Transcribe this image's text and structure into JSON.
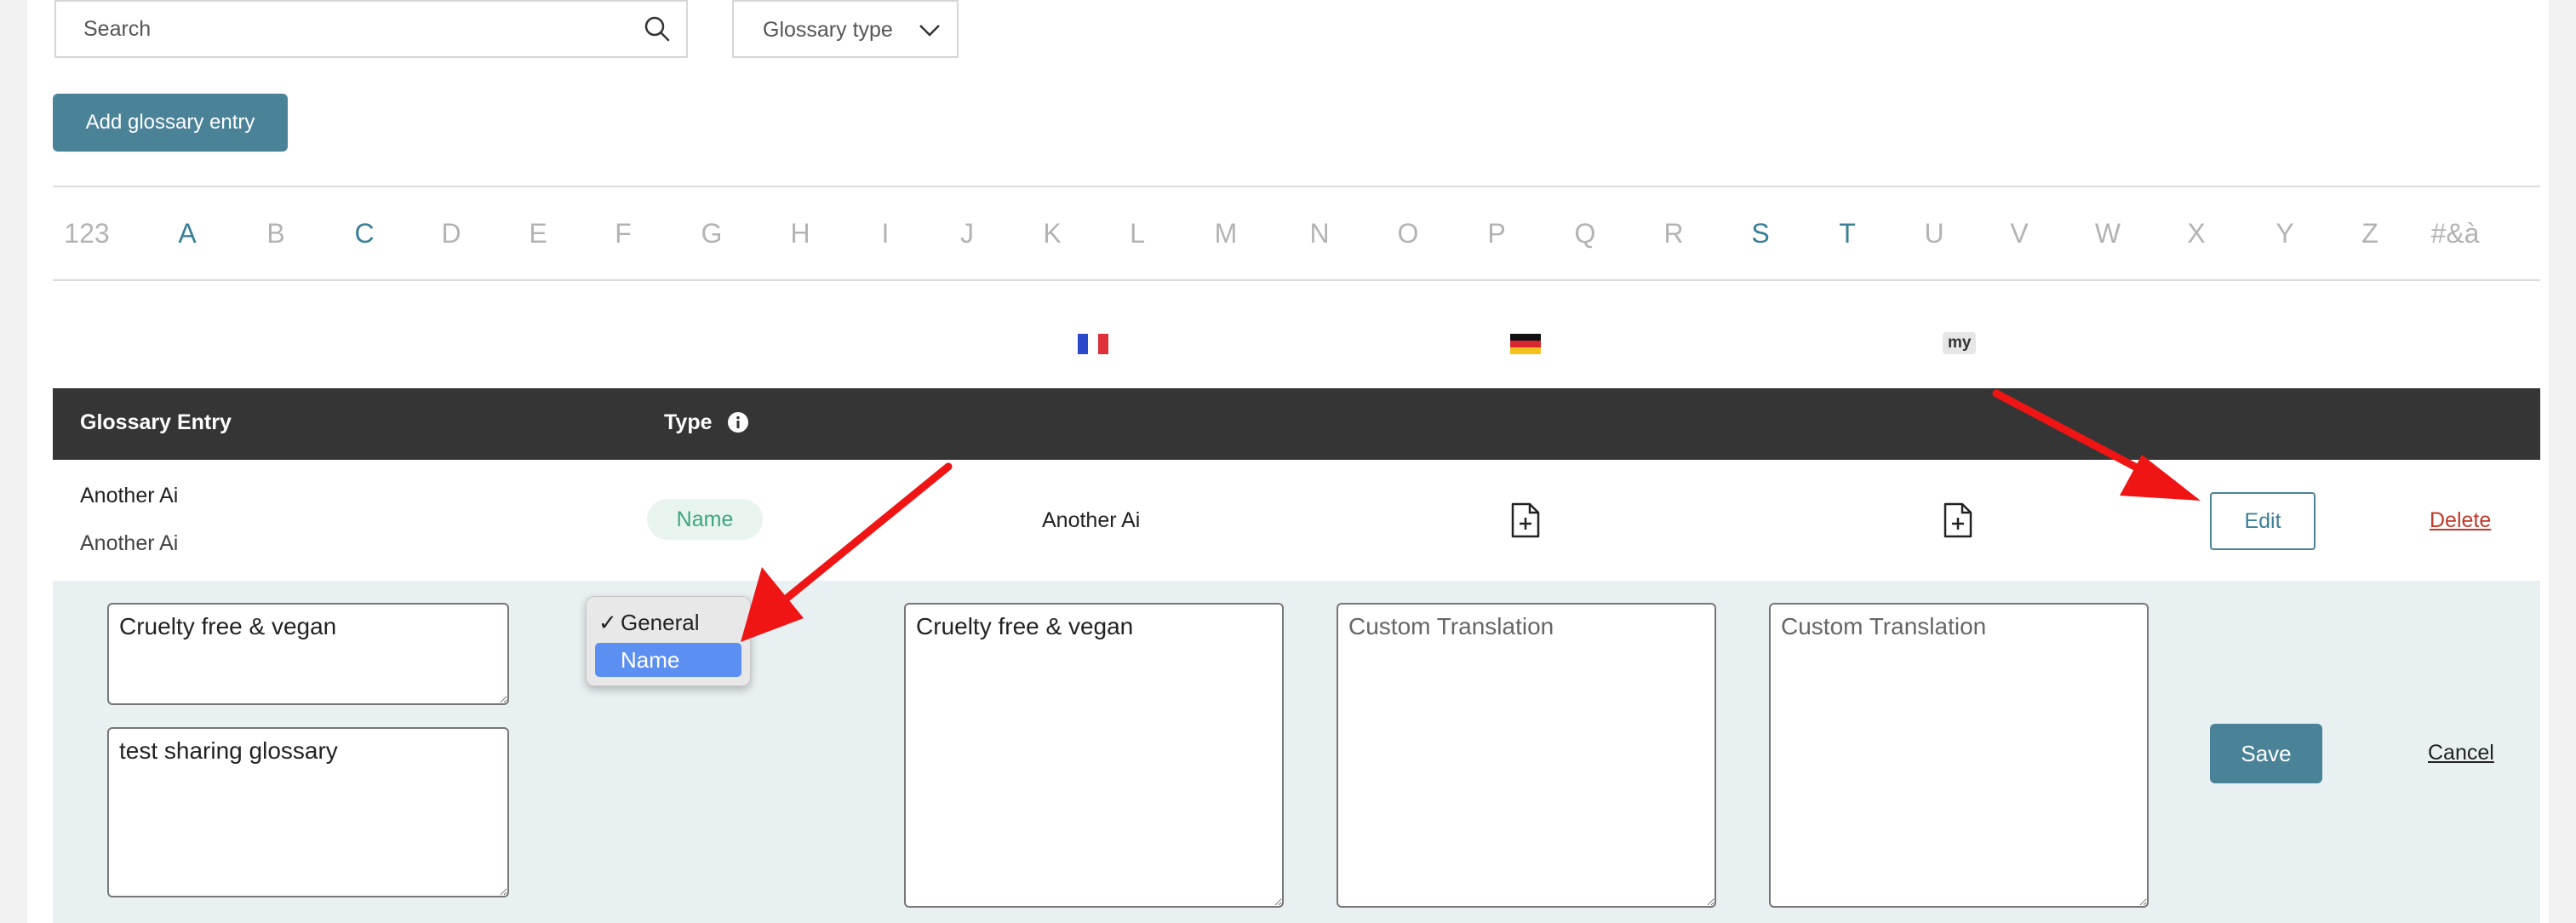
{
  "search": {
    "placeholder": "Search"
  },
  "filter": {
    "glossary_type_label": "Glossary type"
  },
  "actions": {
    "add_entry_label": "Add glossary entry"
  },
  "alphabet": {
    "letters": [
      "123",
      "A",
      "B",
      "C",
      "D",
      "E",
      "F",
      "G",
      "H",
      "I",
      "J",
      "K",
      "L",
      "M",
      "N",
      "O",
      "P",
      "Q",
      "R",
      "S",
      "T",
      "U",
      "V",
      "W",
      "X",
      "Y",
      "Z",
      "#&à"
    ],
    "active": [
      "A",
      "C",
      "S",
      "T"
    ]
  },
  "languages": {
    "my_label": "my"
  },
  "table": {
    "headers": {
      "entry": "Glossary Entry",
      "type": "Type"
    }
  },
  "row": {
    "entry_line1": "Another Ai",
    "entry_line2": "Another Ai",
    "type": "Name",
    "fr_translation": "Another Ai",
    "edit_label": "Edit",
    "delete_label": "Delete"
  },
  "edit_form": {
    "entry_value": "Cruelty free & vegan",
    "description_value": "test sharing glossary",
    "fr_value": "Cruelty free & vegan",
    "de_placeholder": "Custom Translation",
    "my_placeholder": "Custom Translation",
    "save_label": "Save",
    "cancel_label": "Cancel",
    "type_options": [
      {
        "label": "General",
        "checked": true
      },
      {
        "label": "Name",
        "highlighted": true
      }
    ]
  },
  "colors": {
    "accent": "#4a8298",
    "header_bg": "#353535",
    "edit_bg": "#e9f0f2",
    "delete": "#c0392b",
    "annotation_arrow": "#f01515"
  }
}
